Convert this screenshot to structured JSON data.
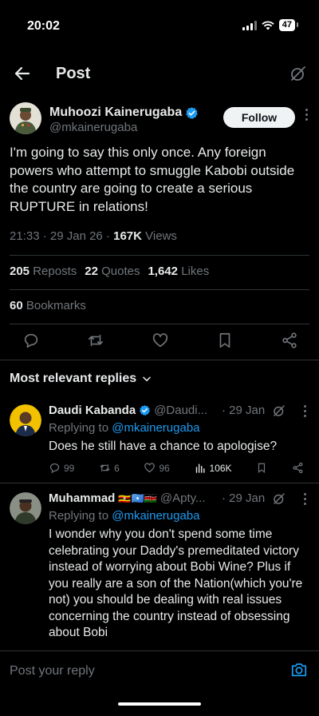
{
  "status_bar": {
    "time": "20:02",
    "battery": "47"
  },
  "header": {
    "title": "Post"
  },
  "tweet": {
    "author_name": "Muhoozi Kainerugaba",
    "author_handle": "@mkainerugaba",
    "follow_label": "Follow",
    "text": "I'm going to say this only once. Any foreign powers who attempt to smuggle Kabobi outside the country are going to create a serious RUPTURE in relations!",
    "time": "21:33",
    "date": "29 Jan 26",
    "views_count": "167K",
    "views_label": "Views",
    "reposts_count": "205",
    "reposts_label": "Reposts",
    "quotes_count": "22",
    "quotes_label": "Quotes",
    "likes_count": "1,642",
    "likes_label": "Likes",
    "bookmarks_count": "60",
    "bookmarks_label": "Bookmarks"
  },
  "replies_section": {
    "sort_label": "Most relevant replies"
  },
  "replies": [
    {
      "name": "Daudi Kabanda",
      "handle": "@Daudi...",
      "time": "29 Jan",
      "replying_prefix": "Replying to",
      "replying_handle": "@mkainerugaba",
      "text": "Does he still have a chance to apologise?",
      "stats": {
        "replies": "99",
        "reposts": "6",
        "likes": "96",
        "views": "106K"
      }
    },
    {
      "name": "Muhammad",
      "flags": "🇺🇬🇸🇴🇰🇪",
      "handle": "@Apty...",
      "time": "29 Jan",
      "replying_prefix": "Replying to",
      "replying_handle": "@mkainerugaba",
      "text": "I wonder why you don't spend some time celebrating your Daddy's premeditated victory instead of worrying about Bobi Wine? Plus if you really are a son of the Nation(which you're not) you should be dealing with real issues concerning the country instead of obsessing about Bobi"
    }
  ],
  "compose": {
    "placeholder": "Post your reply"
  },
  "colors": {
    "accent": "#1d9bf0",
    "muted": "#71767b",
    "text": "#e7e9ea",
    "background": "#000000"
  }
}
